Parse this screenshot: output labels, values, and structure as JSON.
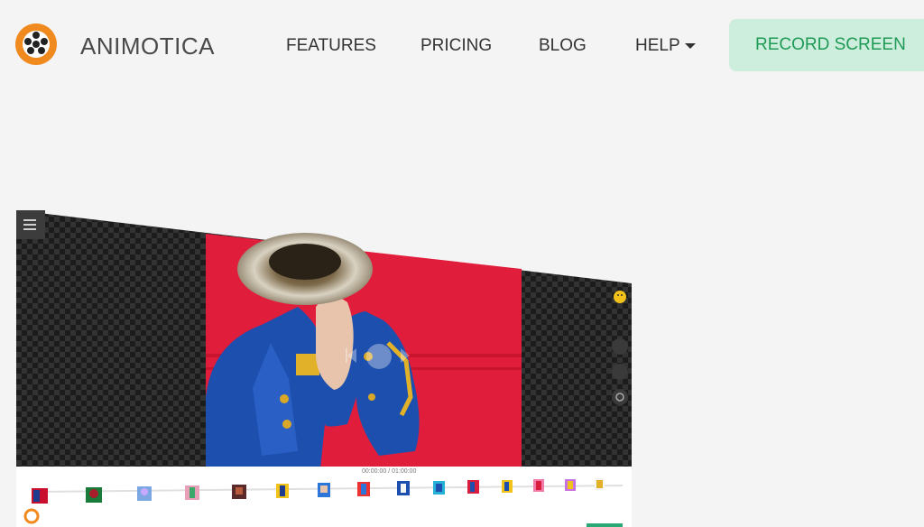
{
  "brand": {
    "name": "ANIMOTICA"
  },
  "nav": {
    "features": "FEATURES",
    "pricing": "PRICING",
    "blog": "BLOG",
    "help": "HELP",
    "record": "RECORD SCREEN"
  },
  "colors": {
    "accent": "#f08a1f",
    "record_bg": "#cdeedd",
    "record_text": "#1e9a55"
  },
  "editor": {
    "timecode": "00:00:00 / 01:00:00",
    "icons": [
      "menu-icon",
      "emoji-icon",
      "skip-back-icon",
      "play-icon",
      "skip-forward-icon",
      "settings-icon"
    ]
  }
}
